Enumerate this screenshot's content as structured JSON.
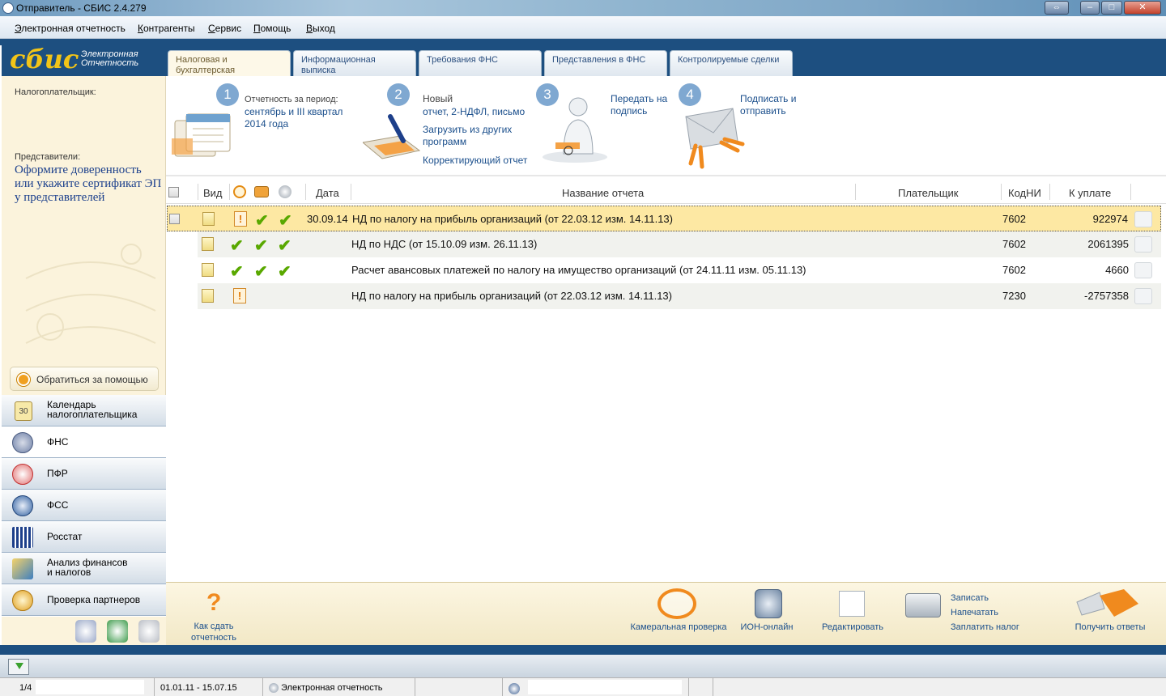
{
  "window": {
    "title": "Отправитель - СБИС 2.4.279"
  },
  "menu": [
    "Электронная отчетность",
    "Контрагенты",
    "Сервис",
    "Помощь",
    "Выход"
  ],
  "logo": {
    "brand": "сбис",
    "sub1": "Электронная",
    "sub2": "Отчетность"
  },
  "left": {
    "taxpayer_label": "Налогоплательщик:",
    "reps_label": "Представители:",
    "reps_link": "Оформите доверенность или укажите сертификат ЭП у представителей",
    "help_button": "Обратиться за помощью",
    "nav": [
      {
        "l1": "Календарь",
        "l2": "налогоплательщика"
      },
      {
        "l1": "ФНС"
      },
      {
        "l1": "ПФР"
      },
      {
        "l1": "ФСС"
      },
      {
        "l1": "Росстат"
      },
      {
        "l1": "Анализ финансов",
        "l2": "и налогов"
      },
      {
        "l1": "Проверка партнеров"
      }
    ],
    "calendar_day": "30"
  },
  "tabs": [
    {
      "l1": "Налоговая и",
      "l2": "бухгалтерская отчетность"
    },
    {
      "l1": "Информационная выписка"
    },
    {
      "l1": "Требования ФНС"
    },
    {
      "l1": "Представления в ФНС"
    },
    {
      "l1": "Контролируемые сделки"
    }
  ],
  "steps": {
    "s1": {
      "num": "1",
      "label": "Отчетность за период:",
      "l2": "сентябрь и III квартал",
      "l3": "2014 года"
    },
    "s2": {
      "num": "2",
      "l1": "Новый",
      "l2": "отчет, 2-НДФЛ, письмо",
      "l3": "Загрузить из других",
      "l4": "программ",
      "l5": "Корректирующий отчет"
    },
    "s3": {
      "num": "3",
      "l1": "Передать на",
      "l2": "подпись"
    },
    "s4": {
      "num": "4",
      "l1": "Подписать и",
      "l2": "отправить"
    }
  },
  "table": {
    "headers": {
      "view": "Вид",
      "date": "Дата",
      "name": "Название отчета",
      "payer": "Плательщик",
      "code": "КодНИ",
      "pay": "К уплате"
    },
    "rows": [
      {
        "date": "30.09.14",
        "name": "НД по налогу на прибыль организаций (от 22.03.12 изм. 14.11.13)",
        "code": "7602",
        "pay": "922974",
        "status": "warn",
        "checks": 2
      },
      {
        "date": "",
        "name": "НД по НДС (от 15.10.09 изм. 26.11.13)",
        "code": "7602",
        "pay": "2061395",
        "status": "ok",
        "checks": 2
      },
      {
        "date": "",
        "name": "Расчет авансовых платежей по налогу на имущество организаций (от 24.11.11 изм. 05.11.13)",
        "code": "7602",
        "pay": "4660",
        "status": "ok",
        "checks": 2
      },
      {
        "date": "",
        "name": "НД по налогу на прибыль организаций (от 22.03.12 изм. 14.11.13)",
        "code": "7230",
        "pay": "-2757358",
        "status": "warn",
        "checks": 0
      }
    ]
  },
  "bottom": {
    "how": {
      "l1": "Как сдать",
      "l2": "отчетность"
    },
    "cameral": "Камеральная проверка",
    "ion": "ИОН-онлайн",
    "edit": "Редактировать",
    "write": "Записать",
    "print": "Напечатать",
    "pay_tax": "Заплатить налог",
    "answers": "Получить ответы"
  },
  "status": {
    "page": "1/4",
    "period": "01.01.11 - 15.07.15",
    "mode": "Электронная отчетность"
  },
  "colors": {
    "brand_blue": "#1d4f80",
    "logo_yellow": "#f2c418",
    "row_selected": "#fde8a3",
    "check_green": "#59a800",
    "link_blue": "#1b4f8c"
  }
}
